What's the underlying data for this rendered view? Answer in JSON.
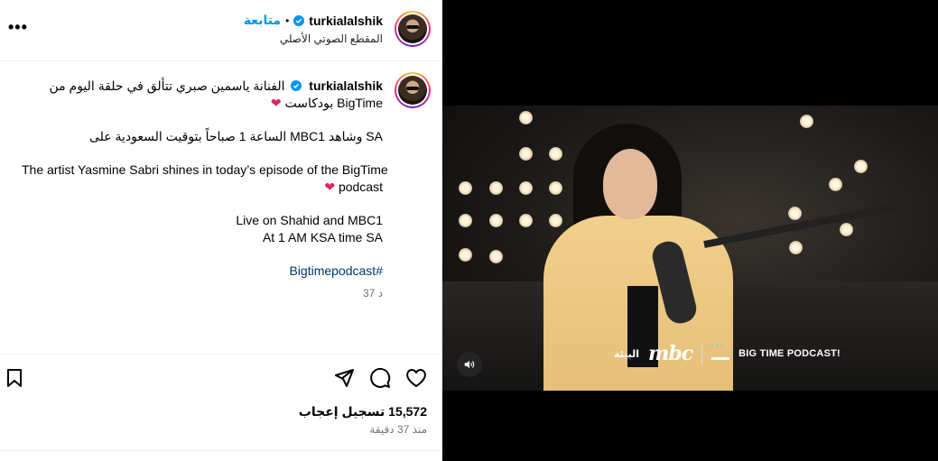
{
  "header": {
    "username": "turkialalshik",
    "dot": "•",
    "follow_label": "متابعة",
    "audio_label": "المقطع الصوتي الأصلي",
    "more_icon": "more-horizontal-icon"
  },
  "caption": {
    "username": "turkialalshik",
    "line1": "الفنانة ياسمين صبري تتألق في حلقة اليوم من",
    "line2": "بودكاست BigTime",
    "line3": "الساعة 1 صباحاً بتوقيت السعودية على MBC1 وشاهد SA",
    "line4": "The artist Yasmine Sabri shines in today’s episode of the BigTime",
    "line5": "podcast",
    "line6": "Live on Shahid and MBC1",
    "line7": "At 1 AM KSA time SA",
    "hashtag": "Bigtimepodcast#",
    "time": "37 د",
    "heart": "❤"
  },
  "footer": {
    "likes": "15,572 تسجيل إعجاب",
    "ago": "منذ 37 دقيقة"
  },
  "video": {
    "brand_mbc": "mbc",
    "brand_ar": "البيئة",
    "brand_bt": "BIG TIME PODCAST!"
  },
  "colors": {
    "accent": "#0095f6",
    "verified": "#0095f6",
    "heart": "#e0245e",
    "hashtag": "#00376b"
  }
}
